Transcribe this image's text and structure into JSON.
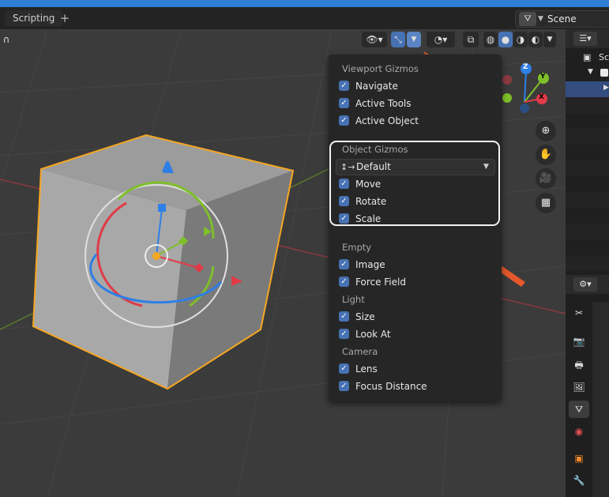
{
  "topbar": {
    "tab_label": "Scripting",
    "add_tab": "+",
    "scene_name": "Scene"
  },
  "colors": {
    "accent": "#4772b3",
    "arrow": "#e4582c",
    "selection": "#f5a623",
    "x_axis": "#e03b47",
    "y_axis": "#7fbf2a",
    "z_axis": "#2e7fe6"
  },
  "navigation_gizmo": {
    "x": "X",
    "y": "Y",
    "z": "Z"
  },
  "popover": {
    "viewport_gizmos": {
      "title": "Viewport Gizmos",
      "items": [
        {
          "label": "Navigate",
          "checked": true
        },
        {
          "label": "Active Tools",
          "checked": true
        },
        {
          "label": "Active Object",
          "checked": true
        }
      ]
    },
    "object_gizmos": {
      "title": "Object Gizmos",
      "orientation": "Default",
      "items": [
        {
          "label": "Move",
          "checked": true
        },
        {
          "label": "Rotate",
          "checked": true
        },
        {
          "label": "Scale",
          "checked": true
        }
      ]
    },
    "empty": {
      "title": "Empty",
      "items": [
        {
          "label": "Image",
          "checked": true
        },
        {
          "label": "Force Field",
          "checked": true
        }
      ]
    },
    "light": {
      "title": "Light",
      "items": [
        {
          "label": "Size",
          "checked": true
        },
        {
          "label": "Look At",
          "checked": true
        }
      ]
    },
    "camera": {
      "title": "Camera",
      "items": [
        {
          "label": "Lens",
          "checked": true
        },
        {
          "label": "Focus Distance",
          "checked": true
        }
      ]
    }
  },
  "outliner": {
    "first_row_label": "Sc"
  }
}
